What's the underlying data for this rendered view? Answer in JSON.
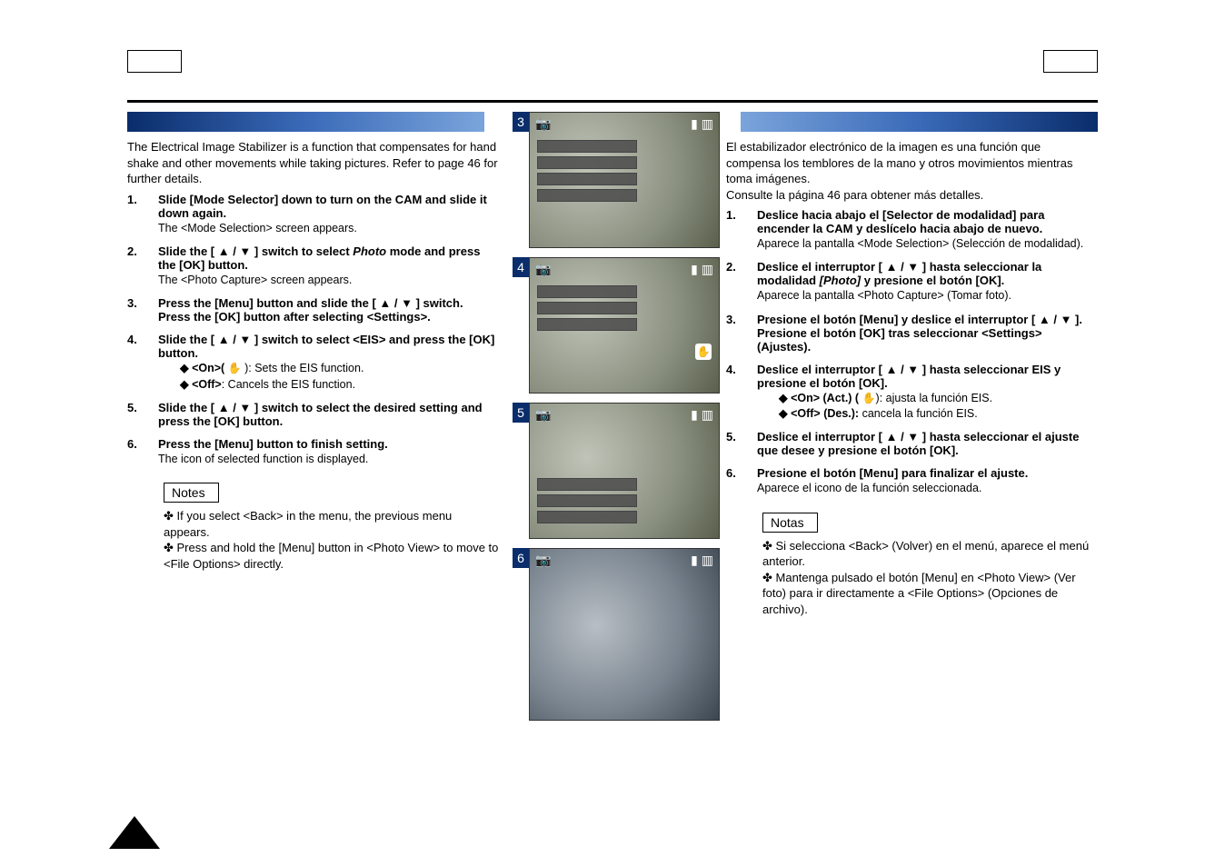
{
  "left": {
    "intro": "The Electrical Image Stabilizer is a function that compensates for hand shake and other movements while taking pictures. Refer to page 46 for further details.",
    "steps": [
      {
        "bold": "Slide [Mode Selector] down to turn on the CAM and slide it down again.",
        "sub": "The <Mode Selection> screen appears."
      },
      {
        "bold_pre": "Slide the [ ▲ / ▼ ] switch to select ",
        "bold_em": "Photo",
        "bold_post": " mode and press the [OK] button.",
        "sub": "The <Photo Capture> screen appears."
      },
      {
        "bold": "Press the [Menu] button and slide the [ ▲ / ▼ ] switch.\nPress the [OK] button after selecting <Settings>.",
        "sub": ""
      },
      {
        "bold": "Slide the [ ▲ / ▼ ] switch to select <EIS> and press the [OK] button.",
        "sub_lines": [
          {
            "label": "◆ <On>( ",
            "symbol": "✋",
            "rest": " ):  Sets the EIS function."
          },
          {
            "label": "◆ <Off>",
            "rest": ":  Cancels the EIS function."
          }
        ]
      },
      {
        "bold": "Slide the [ ▲ / ▼ ] switch to select the desired setting and press the [OK] button.",
        "sub": ""
      },
      {
        "bold": "Press the [Menu] button to finish setting.",
        "sub": "The icon of selected function is displayed."
      }
    ],
    "notes_label": "Notes",
    "notes_body": "✤ If you select <Back> in the menu, the previous menu appears.\n✤ Press and hold the [Menu] button in <Photo View> to move to <File Options> directly."
  },
  "right": {
    "intro": "El estabilizador electrónico de la imagen es una función que compensa los temblores de la mano y otros movimientos mientras toma imágenes.\nConsulte la página 46 para obtener más detalles.",
    "steps": [
      {
        "bold": "Deslice hacia abajo el [Selector de modalidad] para encender la CAM y deslícelo hacia abajo de nuevo.",
        "sub": "Aparece la pantalla <Mode Selection> (Selección de modalidad)."
      },
      {
        "bold_pre": "Deslice el interruptor [ ▲ / ▼ ] hasta seleccionar la modalidad ",
        "bold_em": "[Photo]",
        "bold_post": " y presione el botón [OK].",
        "sub": "Aparece la pantalla <Photo Capture> (Tomar foto)."
      },
      {
        "bold": "Presione el botón [Menu] y deslice el interruptor [ ▲ / ▼ ].\nPresione el botón [OK] tras seleccionar <Settings> (Ajustes).",
        "sub": ""
      },
      {
        "bold": "Deslice el interruptor [ ▲ / ▼ ] hasta seleccionar EIS y presione el botón [OK].",
        "sub_lines": [
          {
            "label": "◆ <On> (Act.) ( ",
            "symbol": "✋",
            "rest": "): ajusta la función EIS."
          },
          {
            "label": "◆ <Off> (Des.):",
            "rest": " cancela la función EIS."
          }
        ]
      },
      {
        "bold": "Deslice el interruptor [ ▲ / ▼ ] hasta seleccionar el ajuste que desee y presione el botón [OK].",
        "sub": ""
      },
      {
        "bold": "Presione el botón [Menu] para finalizar el ajuste.",
        "sub": "Aparece el icono de la función seleccionada."
      }
    ],
    "notes_label": "Notas",
    "notes_body": "✤ Si selecciona <Back> (Volver) en el menú, aparece el menú anterior.\n✤ Mantenga pulsado el botón [Menu] en <Photo View> (Ver foto) para ir directamente a <File Options> (Opciones de archivo)."
  },
  "panels": {
    "nums": [
      "3",
      "4",
      "5",
      "6"
    ],
    "cam_glyph": "📷",
    "card_glyph": "▮",
    "batt_glyph": "▥",
    "hand_glyph": "✋"
  }
}
